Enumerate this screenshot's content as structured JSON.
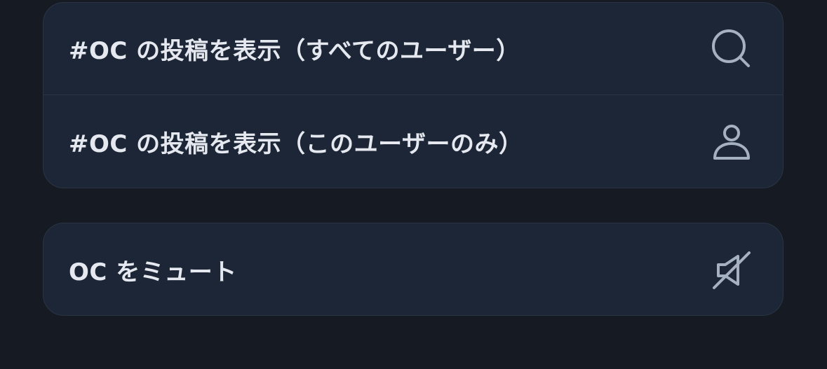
{
  "menu": {
    "group1": [
      {
        "label": "#OC の投稿を表示（すべてのユーザー）",
        "icon": "search-icon"
      },
      {
        "label": "#OC の投稿を表示（このユーザーのみ）",
        "icon": "person-icon"
      }
    ],
    "group2": [
      {
        "label": "OC をミュート",
        "icon": "mute-icon"
      }
    ]
  },
  "colors": {
    "background": "#161b23",
    "card": "#1c2636",
    "text": "#e5e8ef",
    "icon": "#a5b0c1"
  }
}
